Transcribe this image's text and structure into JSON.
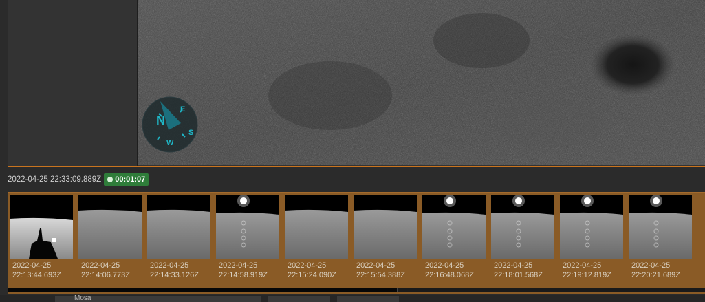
{
  "viewer": {
    "timestamp": "2022-04-25 22:33:09.889Z",
    "elapsed": "00:01:07"
  },
  "compass": {
    "north": "N",
    "east": "E",
    "south": "S",
    "west": "W",
    "accent": "#1fb7c7"
  },
  "filmstrip": {
    "thumbnails": [
      {
        "date": "2022-04-25",
        "time": "22:13:44.693Z",
        "scene": "lander"
      },
      {
        "date": "2022-04-25",
        "time": "22:14:06.773Z",
        "scene": "horizon"
      },
      {
        "date": "2022-04-25",
        "time": "22:14:33.126Z",
        "scene": "horizon"
      },
      {
        "date": "2022-04-25",
        "time": "22:14:58.919Z",
        "scene": "sun"
      },
      {
        "date": "2022-04-25",
        "time": "22:15:24.090Z",
        "scene": "horizon"
      },
      {
        "date": "2022-04-25",
        "time": "22:15:54.388Z",
        "scene": "horizon"
      },
      {
        "date": "2022-04-25",
        "time": "22:16:48.068Z",
        "scene": "sun"
      },
      {
        "date": "2022-04-25",
        "time": "22:18:01.568Z",
        "scene": "sun"
      },
      {
        "date": "2022-04-25",
        "time": "22:19:12.819Z",
        "scene": "sun"
      },
      {
        "date": "2022-04-25",
        "time": "22:20:21.689Z",
        "scene": "sun"
      }
    ]
  },
  "bottom": {
    "label": "Mosa"
  },
  "colors": {
    "frame_border": "#c9741f",
    "filmstrip_bg": "#8a5b26",
    "badge_green": "#2f7d3a"
  }
}
